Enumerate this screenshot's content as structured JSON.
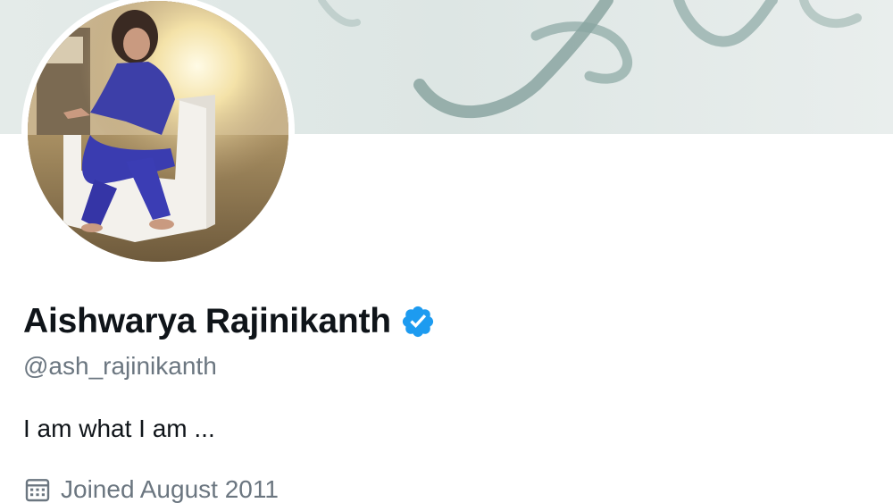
{
  "banner": {
    "image": "profile-header-banner"
  },
  "avatar": {
    "image": "profile-photo"
  },
  "profile": {
    "display_name": "Aishwarya Rajinikanth",
    "verified_icon": "verified-badge-icon",
    "handle": "@ash_rajinikanth",
    "bio": "I am what I am ...",
    "joined_icon": "calendar-icon",
    "joined": "Joined August 2011"
  },
  "colors": {
    "text_primary": "#0f1419",
    "text_secondary": "#6b7680",
    "verified_blue": "#1d9bf0"
  }
}
